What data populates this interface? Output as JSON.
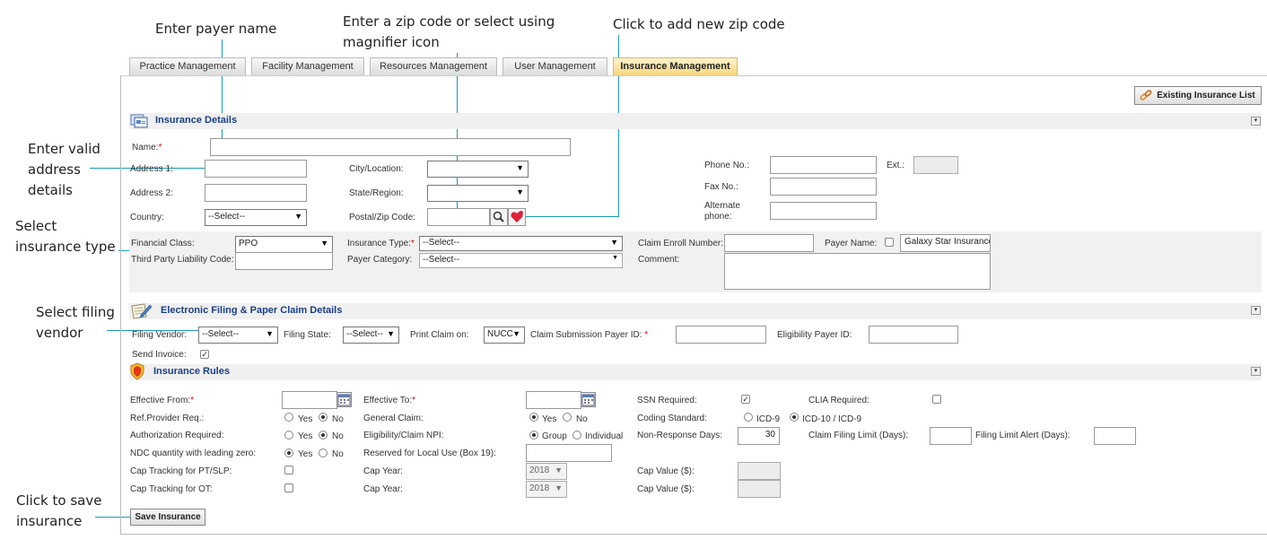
{
  "callouts": {
    "payer_name": "Enter payer name",
    "zip_line1": "Enter a zip code or select using",
    "zip_line2": "magnifier icon",
    "add_zip": "Click to add new zip code",
    "address_line1": "Enter valid",
    "address_line2": "address",
    "address_line3": "details",
    "ins_type_line1": "Select",
    "ins_type_line2": "insurance type",
    "filing_line1": "Select filing",
    "filing_line2": "vendor",
    "save_line1": "Click to save",
    "save_line2": "insurance"
  },
  "tabs": [
    {
      "label": "Practice Management"
    },
    {
      "label": "Facility Management"
    },
    {
      "label": "Resources Management"
    },
    {
      "label": "User Management"
    },
    {
      "label": "Insurance Management"
    }
  ],
  "existing_list_label": "Existing Insurance List",
  "sections": {
    "details": "Insurance Details",
    "filing": "Electronic Filing & Paper Claim Details",
    "rules": "Insurance Rules"
  },
  "details": {
    "name_label": "Name:",
    "address1_label": "Address 1:",
    "address2_label": "Address 2:",
    "country_label": "Country:",
    "country_value": "--Select--",
    "city_label": "City/Location:",
    "state_label": "State/Region:",
    "zip_label": "Postal/Zip Code:",
    "phone_label": "Phone No.:",
    "ext_label": "Ext.:",
    "fax_label": "Fax No.:",
    "alt_phone_label1": "Alternate",
    "alt_phone_label2": "phone:",
    "financial_class_label": "Financial Class:",
    "financial_class_value": "PPO",
    "third_party_label": "Third Party Liability Code:",
    "insurance_type_label": "Insurance Type:",
    "insurance_type_value": "--Select--",
    "payer_category_label": "Payer Category:",
    "payer_category_value": "--Select--",
    "claim_enroll_label": "Claim Enroll Number:",
    "payer_name_label": "Payer Name:",
    "payer_name_value": "Galaxy Star Insurance",
    "comment_label": "Comment:"
  },
  "filing": {
    "vendor_label": "Filing Vendor:",
    "vendor_value": "--Select--",
    "state_label": "Filing State:",
    "state_value": "--Select--",
    "print_claim_label": "Print Claim on:",
    "print_claim_value": "NUCC",
    "submission_label": "Claim Submission Payer ID:",
    "eligibility_label": "Eligibility Payer ID:",
    "send_invoice_label": "Send Invoice:"
  },
  "rules": {
    "effective_from_label": "Effective From:",
    "effective_to_label": "Effective To:",
    "ssn_label": "SSN Required:",
    "clia_label": "CLIA Required:",
    "ref_provider_label": "Ref.Provider Req.:",
    "general_claim_label": "General Claim:",
    "coding_label": "Coding Standard:",
    "icd9": "ICD-9",
    "icd10": "ICD-10 / ICD-9",
    "auth_label": "Authorization Required:",
    "elig_npi_label": "Eligibility/Claim NPI:",
    "group": "Group",
    "individual": "Individual",
    "non_response_label": "Non-Response Days:",
    "non_response_value": "30",
    "claim_filing_label": "Claim Filing Limit (Days):",
    "filing_alert_label": "Filing Limit Alert (Days):",
    "ndc_label": "NDC quantity with leading zero:",
    "reserved_label": "Reserved for Local Use (Box 19):",
    "cap_pt_label": "Cap Tracking for PT/SLP:",
    "cap_ot_label": "Cap Tracking for OT:",
    "cap_year_label": "Cap Year:",
    "cap_year_value": "2018",
    "cap_value_label": "Cap Value ($):",
    "yes": "Yes",
    "no": "No"
  },
  "save_label": "Save Insurance"
}
